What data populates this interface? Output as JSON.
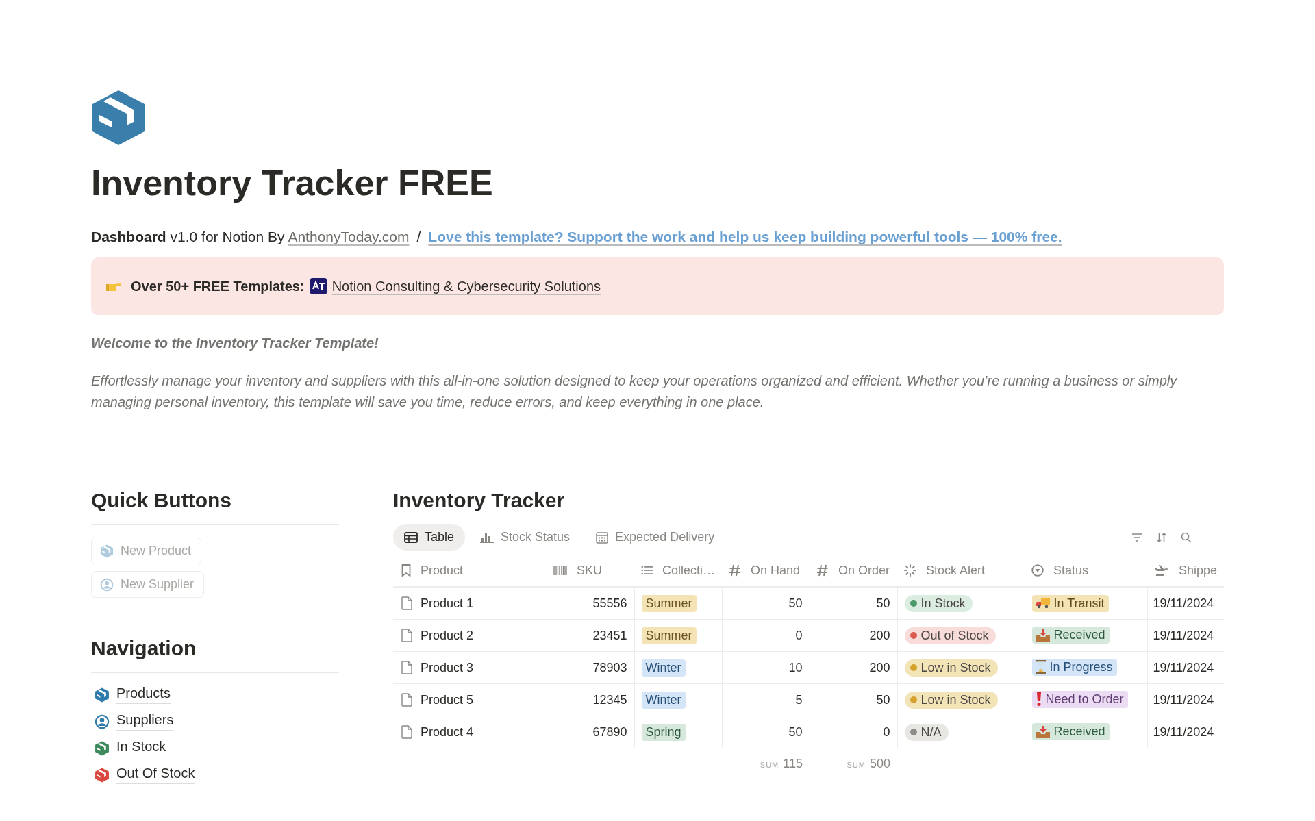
{
  "page": {
    "title": "Inventory Tracker FREE"
  },
  "subtitle": {
    "prefix": "**Dashboard** v1.0 for Notion By ",
    "author_link": "AnthonyToday.com",
    "separator": "/",
    "support_link": "Love this template? Support the work and help us keep building powerful tools — 100% free."
  },
  "banner": {
    "label": "Over 50+ FREE Templates:",
    "link": "Notion Consulting & Cybersecurity Solutions"
  },
  "welcome": "Welcome to the Inventory Tracker Template!",
  "description": "Effortlessly manage your inventory and suppliers with this all-in-one solution designed to keep your operations organized and efficient. Whether you’re running a business or simply managing personal inventory, this template will save you time, reduce errors, and keep everything in one place.",
  "quick_buttons": {
    "title": "Quick Buttons",
    "items": [
      {
        "label": "New Product",
        "kind": "box"
      },
      {
        "label": "New Supplier",
        "kind": "person"
      }
    ]
  },
  "navigation": {
    "title": "Navigation",
    "items": [
      {
        "label": "Products",
        "kind": "box",
        "color": "#2f7bac"
      },
      {
        "label": "Suppliers",
        "kind": "person",
        "color": "#2f7bac"
      },
      {
        "label": "In Stock",
        "kind": "box",
        "color": "#3f8a5c"
      },
      {
        "label": "Out Of Stock",
        "kind": "box",
        "color": "#d9473f"
      }
    ]
  },
  "tracker": {
    "title": "Inventory Tracker",
    "tabs": [
      {
        "label": "Table",
        "kind": "table",
        "selected": true
      },
      {
        "label": "Stock Status",
        "kind": "chart",
        "selected": false
      },
      {
        "label": "Expected Delivery",
        "kind": "calendar",
        "selected": false
      }
    ],
    "columns": [
      {
        "label": "Product",
        "kind": "title"
      },
      {
        "label": "SKU",
        "kind": "barcode"
      },
      {
        "label": "Collecti…",
        "kind": "list"
      },
      {
        "label": "On Hand",
        "kind": "number",
        "sum": {
          "label": "SUM",
          "value": "115"
        }
      },
      {
        "label": "On Order",
        "kind": "number",
        "sum": {
          "label": "SUM",
          "value": "500"
        }
      },
      {
        "label": "Stock Alert",
        "kind": "alert"
      },
      {
        "label": "Status",
        "kind": "status"
      },
      {
        "label": "Shippe",
        "kind": "plane"
      }
    ],
    "rows": [
      {
        "product": "Product 1",
        "sku": "55556",
        "collection": {
          "label": "Summer",
          "color": "#f3e3b5"
        },
        "on_hand": "50",
        "on_order": "50",
        "alert": {
          "label": "In Stock",
          "color": "#4a9a6a"
        },
        "status": {
          "label": "In Transit",
          "kind": "transit"
        },
        "shipped": "19/11/2024"
      },
      {
        "product": "Product 2",
        "sku": "23451",
        "collection": {
          "label": "Summer",
          "color": "#f3e3b5"
        },
        "on_hand": "0",
        "on_order": "200",
        "alert": {
          "label": "Out of Stock",
          "color": "#dd5a50"
        },
        "status": {
          "label": "Received",
          "kind": "received"
        },
        "shipped": "19/11/2024"
      },
      {
        "product": "Product 3",
        "sku": "78903",
        "collection": {
          "label": "Winter",
          "color": "#d3e5f6"
        },
        "on_hand": "10",
        "on_order": "200",
        "alert": {
          "label": "Low in Stock",
          "color": "#d6a22e"
        },
        "status": {
          "label": "In Progress",
          "kind": "progress"
        },
        "shipped": "19/11/2024"
      },
      {
        "product": "Product 5",
        "sku": "12345",
        "collection": {
          "label": "Winter",
          "color": "#d3e5f6"
        },
        "on_hand": "5",
        "on_order": "50",
        "alert": {
          "label": "Low in Stock",
          "color": "#d6a22e"
        },
        "status": {
          "label": "Need to Order",
          "kind": "order"
        },
        "shipped": "19/11/2024"
      },
      {
        "product": "Product 4",
        "sku": "67890",
        "collection": {
          "label": "Spring",
          "color": "#d6e8dc"
        },
        "on_hand": "50",
        "on_order": "0",
        "alert": {
          "label": "N/A",
          "color": "#8f8c88"
        },
        "status": {
          "label": "Received",
          "kind": "received"
        },
        "shipped": "19/11/2024"
      }
    ]
  }
}
